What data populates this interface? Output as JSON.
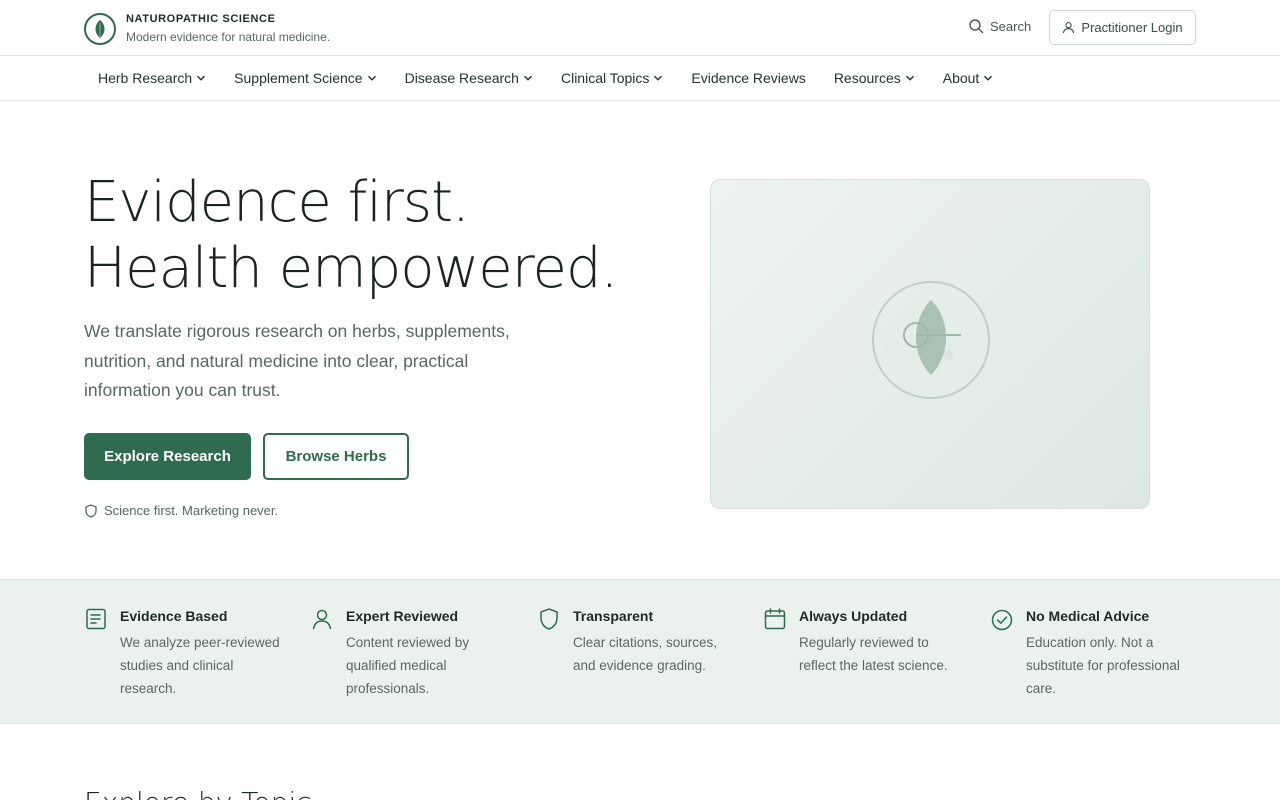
{
  "header": {
    "brand_name": "NATUROPATHIC SCIENCE",
    "brand_tagline": "Modern evidence for natural medicine.",
    "search_label": "Search",
    "login_label": "Practitioner Login"
  },
  "nav": {
    "items": [
      {
        "label": "Herb Research",
        "dropdown": true
      },
      {
        "label": "Supplement Science",
        "dropdown": true
      },
      {
        "label": "Disease Research",
        "dropdown": true
      },
      {
        "label": "Clinical Topics",
        "dropdown": true
      },
      {
        "label": "Evidence Reviews",
        "dropdown": false
      },
      {
        "label": "Resources",
        "dropdown": true
      },
      {
        "label": "About",
        "dropdown": true
      }
    ]
  },
  "hero": {
    "title_line1": "Evidence first.",
    "title_line2": "Health empowered.",
    "subtitle": "We translate rigorous research on herbs, supplements, nutrition, and natural medicine into clear, practical information you can trust.",
    "primary_cta": "Explore Research",
    "secondary_cta": "Browse Herbs",
    "motto": "Science first. Marketing never."
  },
  "features": [
    {
      "icon": "document-icon",
      "title": "Evidence Based",
      "desc": "We analyze peer-reviewed studies and clinical research."
    },
    {
      "icon": "user-icon",
      "title": "Expert Reviewed",
      "desc": "Content reviewed by qualified medical professionals."
    },
    {
      "icon": "shield-icon",
      "title": "Transparent",
      "desc": "Clear citations, sources, and evidence grading."
    },
    {
      "icon": "calendar-icon",
      "title": "Always Updated",
      "desc": "Regularly reviewed to reflect the latest science."
    },
    {
      "icon": "check-circle-icon",
      "title": "No Medical Advice",
      "desc": "Education only. Not a substitute for professional care."
    }
  ],
  "next_section": {
    "title": "Explore by Topic"
  },
  "colors": {
    "brand_green": "#2f6b4f",
    "band_bg": "#ebf2ee",
    "text_muted": "#5a6760"
  }
}
